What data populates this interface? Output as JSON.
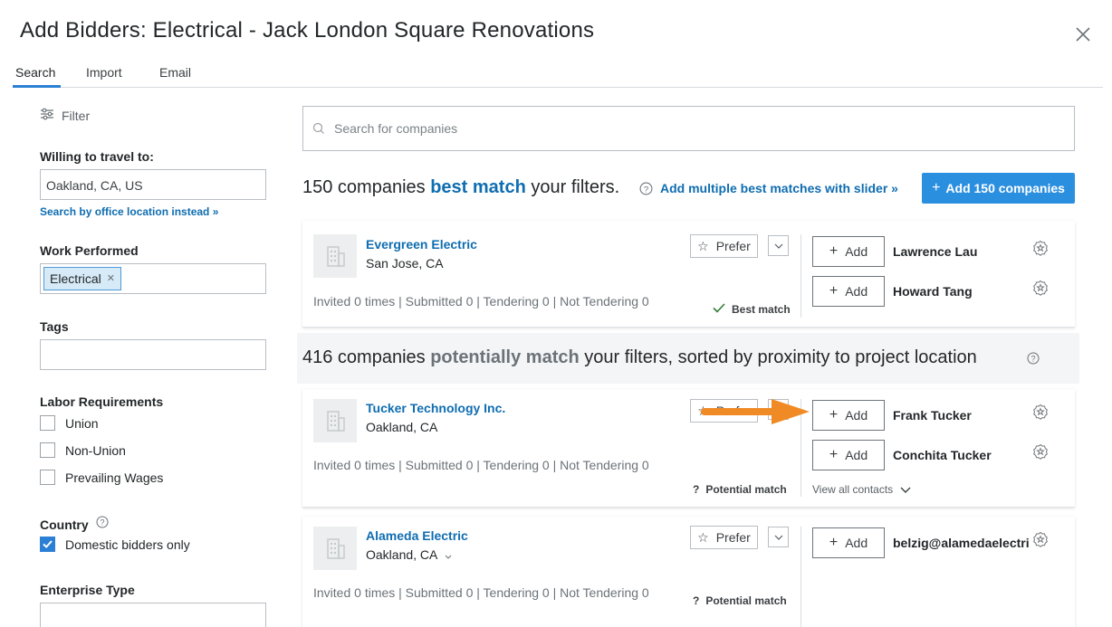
{
  "header": {
    "title": "Add Bidders: Electrical - Jack London Square Renovations"
  },
  "tabs": [
    {
      "label": "Search",
      "active": true
    },
    {
      "label": "Import",
      "active": false
    },
    {
      "label": "Email",
      "active": false
    }
  ],
  "sidebar": {
    "filter_label": "Filter",
    "travel_label": "Willing to travel to:",
    "travel_value": "Oakland, CA, US",
    "office_link": "Search by office location instead »",
    "work_label": "Work Performed",
    "work_chip": "Electrical",
    "tags_label": "Tags",
    "labor_label": "Labor Requirements",
    "labor_options": [
      {
        "label": "Union",
        "checked": false
      },
      {
        "label": "Non-Union",
        "checked": false
      },
      {
        "label": "Prevailing Wages",
        "checked": false
      }
    ],
    "country_label": "Country",
    "country_option": {
      "label": "Domestic bidders only",
      "checked": true
    },
    "enterprise_label": "Enterprise Type"
  },
  "search": {
    "placeholder": "Search for companies"
  },
  "best_match": {
    "count_text": "150 companies",
    "highlight": "best match",
    "suffix": "your filters.",
    "slider_link": "Add multiple best matches with slider »",
    "add_all_button": "Add 150 companies"
  },
  "potential_match": {
    "count_text": "416 companies",
    "highlight": "potentially match",
    "suffix": "your filters, sorted by proximity to project location"
  },
  "cards": [
    {
      "name": "Evergreen Electric",
      "city": "San Jose, CA",
      "stats": "Invited 0 times | Submitted 0 | Tendering 0 | Not Tendering 0",
      "prefer": "Prefer",
      "match": "Best match",
      "contacts": [
        "Lawrence Lau",
        "Howard Tang"
      ],
      "add_label": "Add"
    },
    {
      "name": "Tucker Technology Inc.",
      "city": "Oakland, CA",
      "stats": "Invited 0 times | Submitted 0 | Tendering 0 | Not Tendering 0",
      "prefer": "Prefer",
      "match": "Potential match",
      "contacts": [
        "Frank Tucker",
        "Conchita Tucker"
      ],
      "view_all": "View all contacts",
      "add_label": "Add"
    },
    {
      "name": "Alameda Electric",
      "city": "Oakland, CA",
      "stats": "Invited 0 times | Submitted 0 | Tendering 0 | Not Tendering 0",
      "prefer": "Prefer",
      "match": "Potential match",
      "contacts": [
        "belzig@alamedaelectri"
      ],
      "add_label": "Add"
    }
  ],
  "colors": {
    "accent": "#2b8fe0",
    "link": "#0f6db1",
    "arrow": "#f08a24",
    "best_check": "#2e7d32"
  }
}
